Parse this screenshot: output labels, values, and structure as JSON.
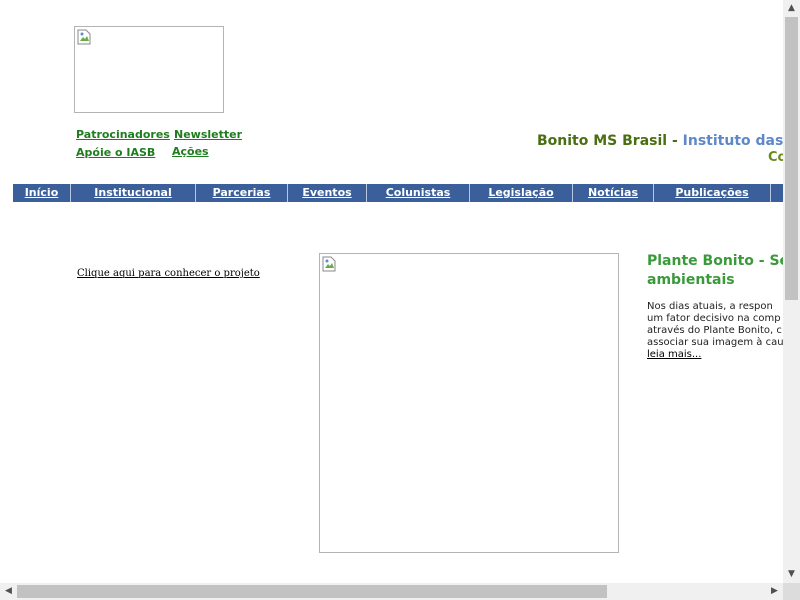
{
  "header": {
    "links": [
      {
        "label": "Patrocinadores"
      },
      {
        "label": "Newsletter"
      },
      {
        "label": "Apóie o IASB"
      },
      {
        "label": "Ações"
      }
    ],
    "title_part1": "Bonito MS Brasil",
    "title_dash": " - ",
    "title_part2": "Instituto das Águ",
    "subtitle_fragment": "Co"
  },
  "nav": {
    "items": [
      {
        "label": "Início"
      },
      {
        "label": "Institucional"
      },
      {
        "label": "Parcerias"
      },
      {
        "label": "Eventos"
      },
      {
        "label": "Colunistas"
      },
      {
        "label": "Legislação"
      },
      {
        "label": "Notícias"
      },
      {
        "label": "Publicações"
      }
    ]
  },
  "main": {
    "project_link": "Clique aqui para conhecer o projeto",
    "feature_title": "Plante Bonito - Sej ambientais",
    "feature_text_lines": [
      "Nos dias atuais, a respon",
      "um fator decisivo na comp",
      "através do Plante Bonito, c",
      "associar sua imagem à cau"
    ],
    "read_more": "leia mais..."
  },
  "colors": {
    "nav_bg": "#3a5f9a",
    "link_green": "#1e7d1e",
    "title_green": "#4a6e12",
    "title_blue": "#5f88c8"
  },
  "icons": [
    "broken-image-icon",
    "scroll-up-arrow-icon",
    "scroll-down-arrow-icon",
    "scroll-left-arrow-icon",
    "scroll-right-arrow-icon"
  ]
}
